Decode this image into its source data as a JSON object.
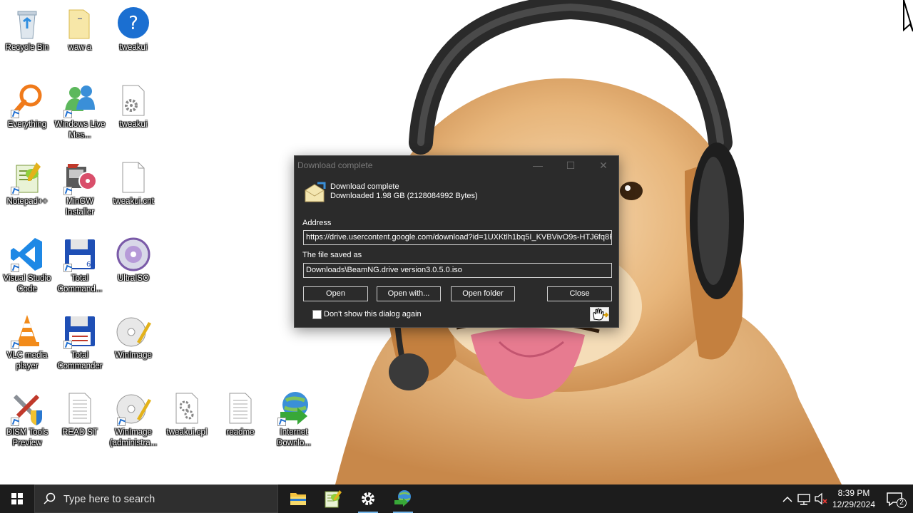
{
  "desktop": {
    "icons": [
      {
        "id": "recycle-bin",
        "label": "Recycle Bin",
        "icon": "recycle-bin-icon"
      },
      {
        "id": "waw-a",
        "label": "waw a",
        "icon": "folder-icon"
      },
      {
        "id": "tweakui-help",
        "label": "tweakui",
        "icon": "help-icon"
      },
      {
        "id": "everything",
        "label": "Everything",
        "icon": "search-magnifier-icon"
      },
      {
        "id": "windows-live",
        "label": "Windows Live Mes...",
        "icon": "messenger-icon"
      },
      {
        "id": "tweakui-file",
        "label": "tweakui",
        "icon": "settings-file-icon"
      },
      {
        "id": "notepadpp",
        "label": "Notepad++",
        "icon": "notepad-plus-plus-icon"
      },
      {
        "id": "mingw",
        "label": "MinGW Installer",
        "icon": "installer-icon"
      },
      {
        "id": "tweakui-cnt",
        "label": "tweakui.cnt",
        "icon": "blank-file-icon"
      },
      {
        "id": "vscode",
        "label": "Visual Studio Code",
        "icon": "vscode-icon"
      },
      {
        "id": "total-cmd-64",
        "label": "Total Command...",
        "icon": "floppy-disk-icon"
      },
      {
        "id": "ultraiso",
        "label": "UltraISO",
        "icon": "disc-icon"
      },
      {
        "id": "vlc",
        "label": "VLC media player",
        "icon": "vlc-cone-icon"
      },
      {
        "id": "total-cmd",
        "label": "Total Commander",
        "icon": "floppy-disk-icon"
      },
      {
        "id": "winimage",
        "label": "WinImage",
        "icon": "disc-pen-icon"
      },
      {
        "id": "dism",
        "label": "DISM Tools Preview",
        "icon": "tools-shield-icon"
      },
      {
        "id": "readme-txt",
        "label": "READ ST",
        "icon": "text-file-icon"
      },
      {
        "id": "winimage-admin",
        "label": "WinImage (administra...",
        "icon": "disc-pen-icon"
      },
      {
        "id": "tweakui-cpl",
        "label": "tweakui.cpl",
        "icon": "settings-file-icon"
      },
      {
        "id": "readme",
        "label": "readme",
        "icon": "text-file-icon"
      },
      {
        "id": "idm",
        "label": "Internet Downlo...",
        "icon": "globe-download-icon"
      }
    ]
  },
  "dialog": {
    "title": "Download complete",
    "heading": "Download complete",
    "status": "Downloaded 1.98  GB (2128084992 Bytes)",
    "address_label": "Address",
    "address_value": "https://drive.usercontent.google.com/download?id=1UXKtlh1bq5I_KVBVivO9s-HTJ6fq8F",
    "saved_label": "The file saved as",
    "saved_value": "Downloads\\BeamNG.drive version3.0.5.0.iso",
    "buttons": {
      "open": "Open",
      "open_with": "Open with...",
      "open_folder": "Open folder",
      "close": "Close"
    },
    "checkbox_label": "Don't show this dialog again",
    "checkbox_checked": false
  },
  "taskbar": {
    "search_placeholder": "Type here to search",
    "pinned": [
      "file-explorer-icon",
      "notepad-plus-plus-icon",
      "settings-gear-icon",
      "internet-download-manager-icon"
    ],
    "clock_time": "8:39 PM",
    "clock_date": "12/29/2024",
    "notification_count": "2"
  },
  "colors": {
    "taskbar_bg": "#1c1c1c",
    "dialog_bg": "#2b2b2b",
    "accent": "#76b9ed"
  }
}
